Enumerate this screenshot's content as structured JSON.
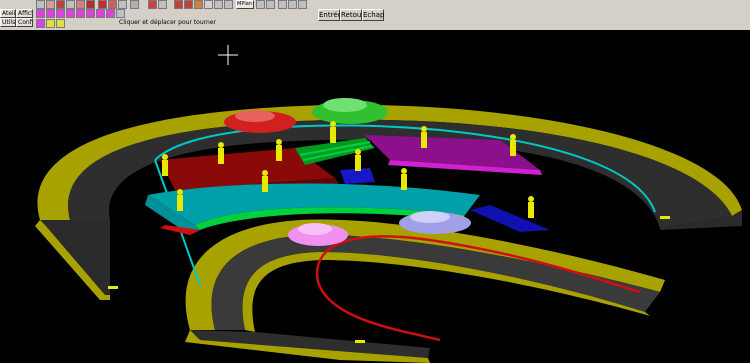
{
  "toolbar": {
    "side_buttons": [
      "Atelier",
      "Affiche",
      "Utils",
      "Config"
    ],
    "status_text": "Cliquer et déplacer pour tourner",
    "command_buttons": [
      "Entrée",
      "Retour",
      "Echap"
    ],
    "dropdown_label": "MPlan"
  },
  "scene": {
    "description_colors": {
      "track": "#2e2e2e",
      "border": "#a8a200",
      "stand_red": "#8a0a0a",
      "stand_teal": "#00a0a8",
      "stand_green": "#009a20",
      "stand_purple": "#8c108c",
      "stand_blue": "#1010b0",
      "figures": "#e8e800"
    }
  }
}
